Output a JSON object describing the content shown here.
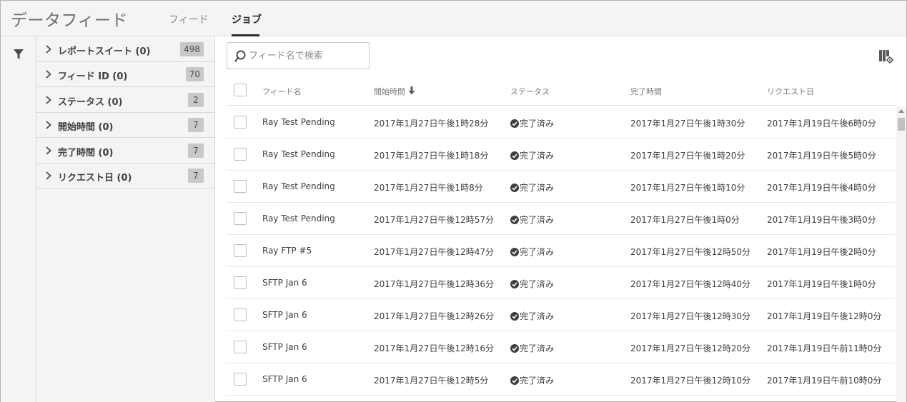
{
  "header": {
    "title": "データフィード",
    "tabs": [
      {
        "label": "フィード",
        "active": false
      },
      {
        "label": "ジョブ",
        "active": true
      }
    ]
  },
  "facets": [
    {
      "label": "レポートスイート (0)",
      "count": "498"
    },
    {
      "label": "フィード ID (0)",
      "count": "70"
    },
    {
      "label": "ステータス (0)",
      "count": "2"
    },
    {
      "label": "開始時間 (0)",
      "count": "7"
    },
    {
      "label": "完了時間 (0)",
      "count": "7"
    },
    {
      "label": "リクエスト日 (0)",
      "count": "7"
    }
  ],
  "search": {
    "placeholder": "フィード名で検索",
    "value": ""
  },
  "table": {
    "columns": [
      "フィード名",
      "開始時間",
      "ステータス",
      "完了時間",
      "リクエスト日"
    ],
    "sorted_column": "開始時間",
    "sort_direction": "descending",
    "rows": [
      [
        "Ray Test Pending",
        "2017年1月27日午後1時28分",
        "完了済み",
        "2017年1月27日午後1時30分",
        "2017年1月19日午後6時0分"
      ],
      [
        "Ray Test Pending",
        "2017年1月27日午後1時18分",
        "完了済み",
        "2017年1月27日午後1時20分",
        "2017年1月19日午後5時0分"
      ],
      [
        "Ray Test Pending",
        "2017年1月27日午後1時8分",
        "完了済み",
        "2017年1月27日午後1時10分",
        "2017年1月19日午後4時0分"
      ],
      [
        "Ray Test Pending",
        "2017年1月27日午後12時57分",
        "完了済み",
        "2017年1月27日午後1時0分",
        "2017年1月19日午後3時0分"
      ],
      [
        "Ray FTP #5",
        "2017年1月27日午後12時47分",
        "完了済み",
        "2017年1月27日午後12時50分",
        "2017年1月19日午後2時0分"
      ],
      [
        "SFTP Jan 6",
        "2017年1月27日午後12時36分",
        "完了済み",
        "2017年1月27日午後12時40分",
        "2017年1月19日午後1時0分"
      ],
      [
        "SFTP Jan 6",
        "2017年1月27日午後12時26分",
        "完了済み",
        "2017年1月27日午後12時30分",
        "2017年1月19日午後12時0分"
      ],
      [
        "SFTP Jan 6",
        "2017年1月27日午後12時16分",
        "完了済み",
        "2017年1月27日午後12時20分",
        "2017年1月19日午前11時0分"
      ],
      [
        "SFTP Jan 6",
        "2017年1月27日午後12時5分",
        "完了済み",
        "2017年1月27日午後12時10分",
        "2017年1月19日午前10時0分"
      ]
    ]
  },
  "icons": {
    "filter": "filter-icon",
    "search": "search-icon",
    "column_settings": "column-settings-icon",
    "status_complete": "check-circle-icon",
    "sort": "arrow-down-icon",
    "facet_expand": "chevron-right-icon"
  },
  "colors": {
    "header_bg": "#f4f4f4",
    "text": "#3f3f3f",
    "badge_bg": "#c8c8c8"
  }
}
